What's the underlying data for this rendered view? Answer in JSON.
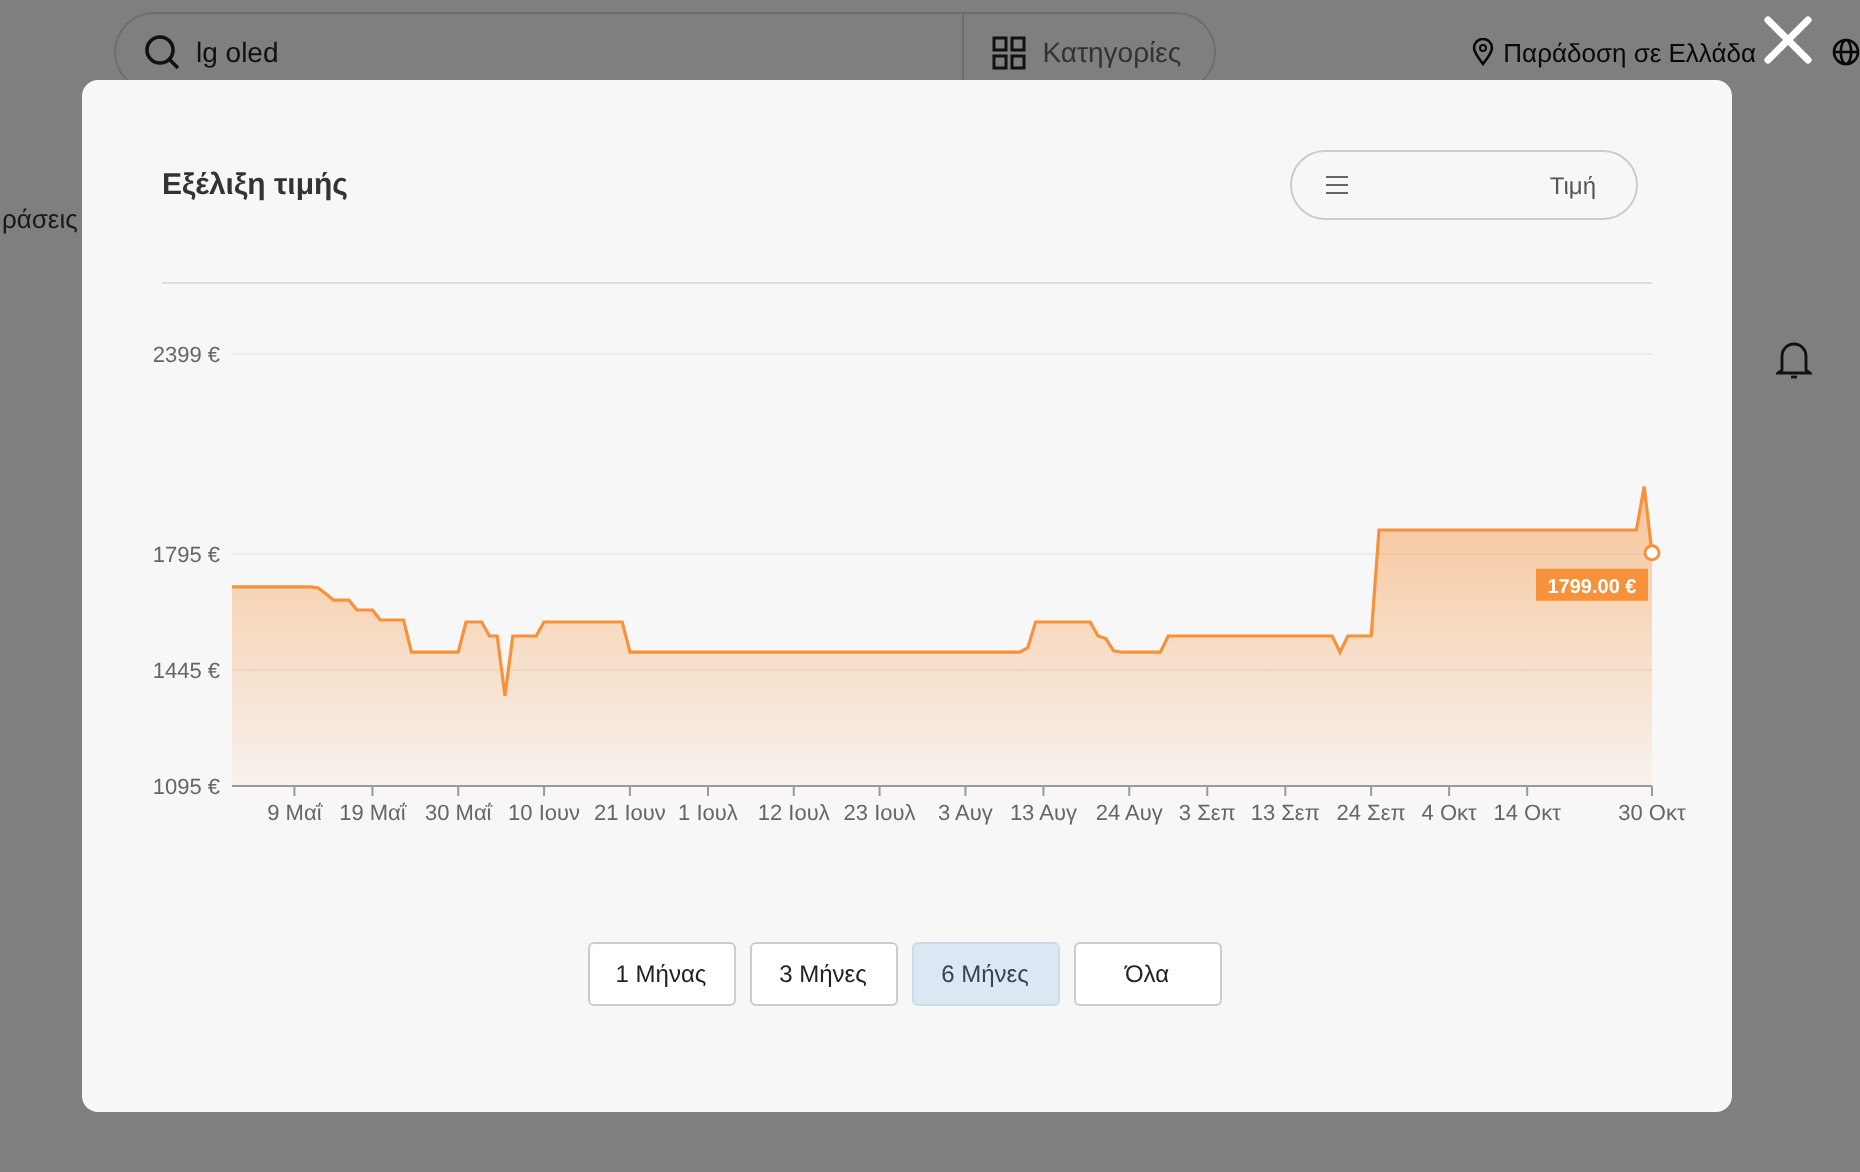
{
  "background_page": {
    "search": {
      "value": "lg oled"
    },
    "categories_button": "Κατηγορίες",
    "delivery": "Παράδοση σε Ελλάδα",
    "side_text": "ράσεις"
  },
  "dialog": {
    "title": "Εξέλιξη τιμής",
    "sort": {
      "label": "Τιμή"
    },
    "chart_data": {
      "type": "area",
      "categories": [
        null,
        null,
        null,
        null,
        null,
        null,
        null,
        null,
        "9 Μαΐ",
        null,
        null,
        null,
        null,
        null,
        null,
        null,
        null,
        null,
        "19 Μαΐ",
        null,
        null,
        null,
        null,
        null,
        null,
        null,
        null,
        null,
        null,
        "30 Μαΐ",
        null,
        null,
        null,
        null,
        null,
        null,
        null,
        null,
        null,
        null,
        "10 Ιουν",
        null,
        null,
        null,
        null,
        null,
        null,
        null,
        null,
        null,
        null,
        "21 Ιουν",
        null,
        null,
        null,
        null,
        null,
        null,
        null,
        null,
        null,
        "1 Ιουλ",
        null,
        null,
        null,
        null,
        null,
        null,
        null,
        null,
        null,
        null,
        "12 Ιουλ",
        null,
        null,
        null,
        null,
        null,
        null,
        null,
        null,
        null,
        null,
        "23 Ιουλ",
        null,
        null,
        null,
        null,
        null,
        null,
        null,
        null,
        null,
        null,
        "3 Αυγ",
        null,
        null,
        null,
        null,
        null,
        null,
        null,
        null,
        null,
        "13 Αυγ",
        null,
        null,
        null,
        null,
        null,
        null,
        null,
        null,
        null,
        null,
        "24 Αυγ",
        null,
        null,
        null,
        null,
        null,
        null,
        null,
        null,
        null,
        "3 Σεπ",
        null,
        null,
        null,
        null,
        null,
        null,
        null,
        null,
        null,
        "13 Σεπ",
        null,
        null,
        null,
        null,
        null,
        null,
        null,
        null,
        null,
        null,
        "24 Σεπ",
        null,
        null,
        null,
        null,
        null,
        null,
        null,
        null,
        null,
        "4 Οκτ",
        null,
        null,
        null,
        null,
        null,
        null,
        null,
        null,
        null,
        "14 Οκτ",
        null,
        null,
        null,
        null,
        null,
        null,
        null,
        null,
        null,
        null,
        null,
        null,
        null,
        null,
        null,
        "30 Οκτ"
      ],
      "series": [
        {
          "color": "#f7923a",
          "values": [
            1696,
            1696,
            1696,
            1696,
            1696,
            1696,
            1696,
            1696,
            1696,
            1696,
            1696,
            1693,
            1676,
            1656,
            1656,
            1656,
            1626,
            1626,
            1626,
            1596,
            1596,
            1596,
            1596,
            1499,
            1499,
            1499,
            1499,
            1499,
            1499,
            1499,
            1590,
            1590,
            1590,
            1548,
            1548,
            1367,
            1548,
            1548,
            1548,
            1548,
            1590,
            1590,
            1590,
            1590,
            1590,
            1590,
            1590,
            1590,
            1590,
            1590,
            1590,
            1499,
            1499,
            1499,
            1499,
            1499,
            1499,
            1499,
            1499,
            1499,
            1499,
            1499,
            1499,
            1499,
            1499,
            1499,
            1499,
            1499,
            1499,
            1499,
            1499,
            1499,
            1499,
            1499,
            1499,
            1499,
            1499,
            1499,
            1499,
            1499,
            1499,
            1499,
            1499,
            1499,
            1499,
            1499,
            1499,
            1499,
            1499,
            1499,
            1499,
            1499,
            1499,
            1499,
            1499,
            1499,
            1499,
            1499,
            1499,
            1499,
            1499,
            1499,
            1513,
            1590,
            1590,
            1590,
            1590,
            1590,
            1590,
            1590,
            1590,
            1548,
            1540,
            1503,
            1499,
            1499,
            1499,
            1499,
            1499,
            1499,
            1548,
            1548,
            1548,
            1548,
            1548,
            1548,
            1548,
            1548,
            1548,
            1548,
            1548,
            1548,
            1548,
            1548,
            1548,
            1548,
            1548,
            1548,
            1548,
            1548,
            1548,
            1548,
            1499,
            1548,
            1548,
            1548,
            1548,
            1868,
            1868,
            1868,
            1868,
            1868,
            1868,
            1868,
            1868,
            1868,
            1868,
            1868,
            1868,
            1868,
            1868,
            1868,
            1868,
            1868,
            1868,
            1868,
            1868,
            1868,
            1868,
            1868,
            1868,
            1868,
            1868,
            1868,
            1868,
            1868,
            1868,
            1868,
            1868,
            1868,
            1868,
            1999,
            1799
          ]
        }
      ],
      "ylim": [
        1095,
        2399
      ],
      "yticks": [
        {
          "value": 2399,
          "label": "2399 €"
        },
        {
          "value": 1795,
          "label": "1795 €"
        },
        {
          "value": 1445,
          "label": "1445 €"
        },
        {
          "value": 1095,
          "label": "1095 €"
        }
      ],
      "annotations": [
        "1799.00 €"
      ]
    },
    "ranges": [
      {
        "label": "1 Μήνας",
        "selected": false
      },
      {
        "label": "3 Μήνες",
        "selected": false
      },
      {
        "label": "6 Μήνες",
        "selected": true
      },
      {
        "label": "Όλα",
        "selected": false
      }
    ]
  }
}
